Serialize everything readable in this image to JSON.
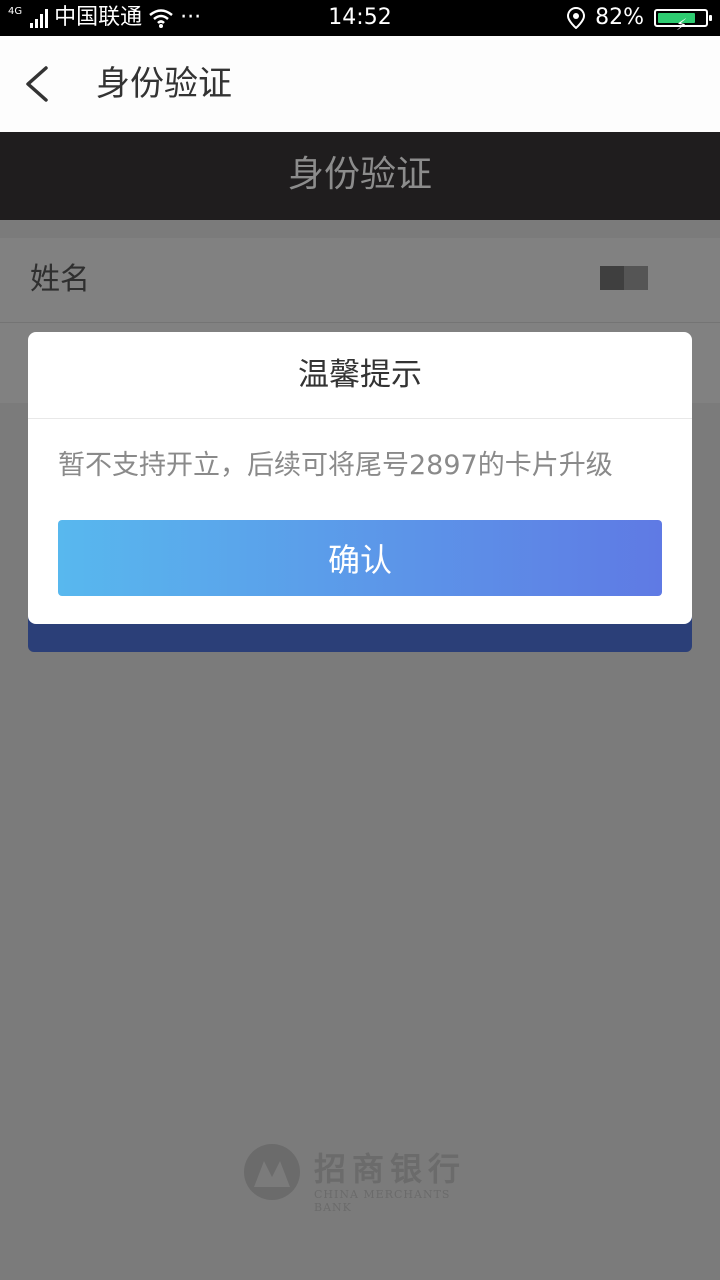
{
  "status_bar": {
    "network": "4G",
    "carrier": "中国联通",
    "more": "···",
    "time": "14:52",
    "battery_percent": "82%",
    "battery_level": 0.82
  },
  "header": {
    "title": "身份验证"
  },
  "page": {
    "banner_title": "身份验证",
    "name_label": "姓名"
  },
  "dialog": {
    "title": "温馨提示",
    "message": "暂不支持开立，后续可将尾号2897的卡片升级",
    "confirm_label": "确认"
  },
  "footer": {
    "bank_name": "招商银行",
    "bank_name_en": "CHINA MERCHANTS BANK"
  }
}
